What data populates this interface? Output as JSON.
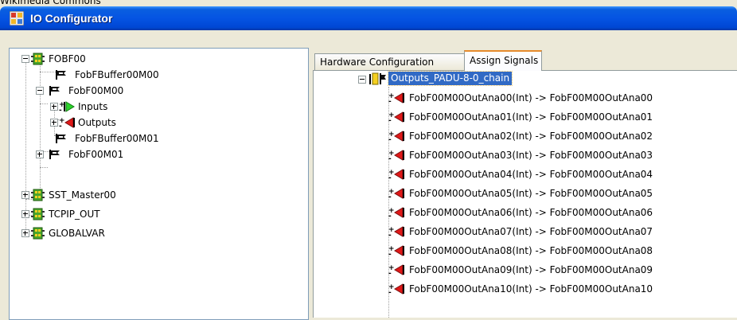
{
  "top_crop_text": "Wikimedia Commons",
  "window": {
    "title": "IO Configurator"
  },
  "tree": {
    "fobf00": "FOBF00",
    "fobfbuffer00m00": "FobFBuffer00M00",
    "fobf00m00": "FobF00M00",
    "inputs": "Inputs",
    "outputs": "Outputs",
    "fobfbuffer00m01": "FobFBuffer00M01",
    "fobf00m01": "FobF00M01",
    "sst_master00": "SST_Master00",
    "tcpip_out": "TCPIP_OUT",
    "globalvar": "GLOBALVAR"
  },
  "tabs": {
    "hardware": "Hardware Configuration",
    "assign": "Assign Signals"
  },
  "signals": {
    "root": "Outputs_PADU-8-0_chain",
    "items": [
      "FobF00M00OutAna00(Int) -> FobF00M00OutAna00",
      "FobF00M00OutAna01(Int) -> FobF00M00OutAna01",
      "FobF00M00OutAna02(Int) -> FobF00M00OutAna02",
      "FobF00M00OutAna03(Int) -> FobF00M00OutAna03",
      "FobF00M00OutAna04(Int) -> FobF00M00OutAna04",
      "FobF00M00OutAna05(Int) -> FobF00M00OutAna05",
      "FobF00M00OutAna06(Int) -> FobF00M00OutAna06",
      "FobF00M00OutAna07(Int) -> FobF00M00OutAna07",
      "FobF00M00OutAna08(Int) -> FobF00M00OutAna08",
      "FobF00M00OutAna09(Int) -> FobF00M00OutAna09",
      "FobF00M00OutAna10(Int) -> FobF00M00OutAna10"
    ]
  },
  "icons": {
    "app": "io-configurator-icon",
    "device": "green-device-icon",
    "flag": "black-flag-icon",
    "input_arrow": "green-input-arrow-icon",
    "output_arrow": "red-output-arrow-icon",
    "chain": "chain-icon"
  },
  "colors": {
    "title_bar": "#0554e3",
    "selection": "#316ac5",
    "input_green": "#2bd32b",
    "output_red": "#e01818",
    "device_green": "#4aa62b",
    "tab_highlight": "#e68b2c"
  }
}
